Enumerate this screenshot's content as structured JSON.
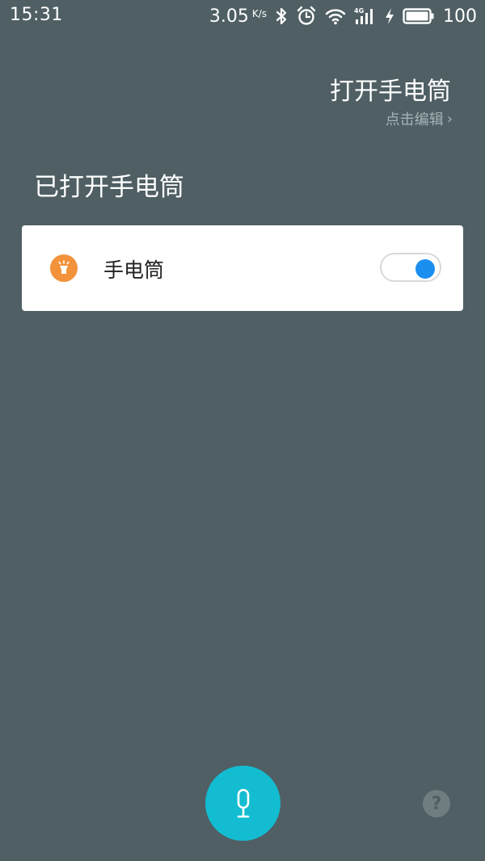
{
  "status_bar": {
    "time": "15:31",
    "net_speed": "3.05",
    "net_speed_unit": "K/s",
    "network_type": "4G",
    "battery": "100",
    "icons": [
      "bluetooth-icon",
      "alarm-icon",
      "wifi-icon",
      "signal-icon",
      "charging-icon",
      "battery-icon"
    ]
  },
  "query": {
    "text": "打开手电筒",
    "edit_label": "点击编辑",
    "edit_chevron": "›"
  },
  "response": {
    "text": "已打开手电筒"
  },
  "card": {
    "icon": "flashlight-icon",
    "label": "手电筒",
    "toggle_on": true
  },
  "bottom": {
    "mic_icon": "microphone-icon",
    "help_label": "?"
  },
  "colors": {
    "background": "#4f5f64",
    "accent_mic": "#13bcd1",
    "toggle_on": "#1b8ff0",
    "flashlight_icon_bg": "#f2923a"
  }
}
